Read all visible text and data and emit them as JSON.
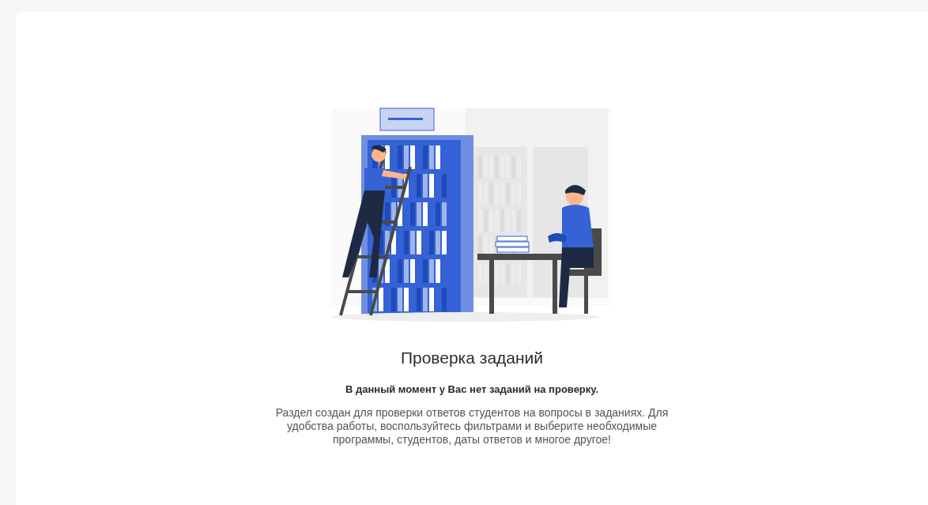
{
  "empty_state": {
    "title": "Проверка заданий",
    "subtitle": "В данный момент у Вас нет заданий на проверку.",
    "description": "Раздел создан для проверки ответов студентов на вопросы в заданиях. Для удобства работы, воспользуйтесь фильтрами и выберите необходимые программы, студентов, даты ответов и многое другое!"
  }
}
